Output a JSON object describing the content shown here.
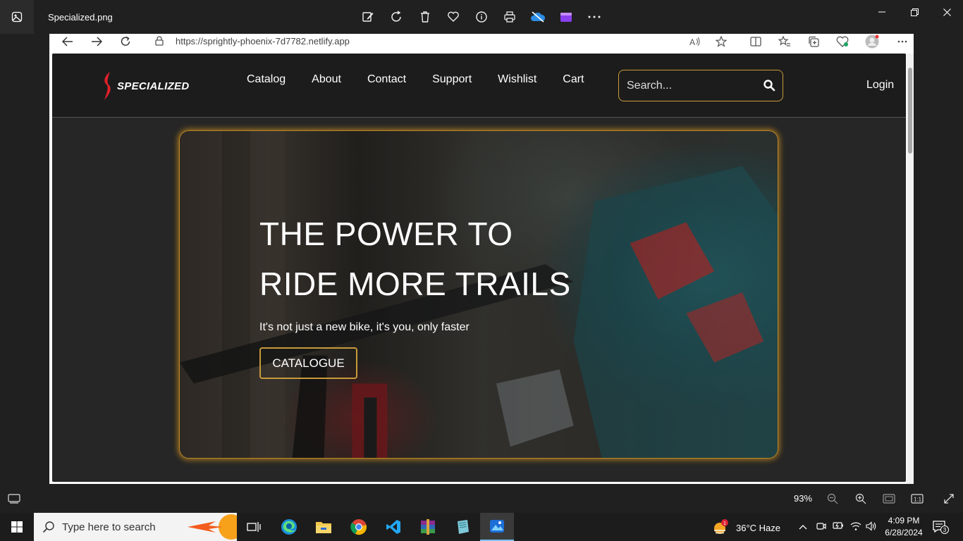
{
  "photos_app": {
    "file_name": "Specialized.png",
    "toolbar_icons": [
      "edit-icon",
      "rotate-icon",
      "delete-icon",
      "favorite-icon",
      "info-icon",
      "print-icon",
      "onedrive-icon",
      "clipchamp-icon",
      "more-icon"
    ],
    "zoom_level": "93%"
  },
  "browser": {
    "url": "https://sprightly-phoenix-7d7782.netlify.app"
  },
  "website": {
    "logo_text": "SPECIALIZED",
    "nav": [
      "Catalog",
      "About",
      "Contact",
      "Support",
      "Wishlist",
      "Cart"
    ],
    "search_placeholder": "Search...",
    "login": "Login",
    "accent_color": "#c89a3a",
    "hero": {
      "title_line1": "THE POWER TO",
      "title_line2": "RIDE MORE TRAILS",
      "subtitle": "It's not just a new bike, it's you, only faster",
      "button": "CATALOGUE"
    }
  },
  "taskbar": {
    "search_placeholder": "Type here to search",
    "weather": "36°C  Haze",
    "weather_badge": "1",
    "time": "4:09 PM",
    "date": "6/28/2024",
    "notification_count": "3"
  }
}
